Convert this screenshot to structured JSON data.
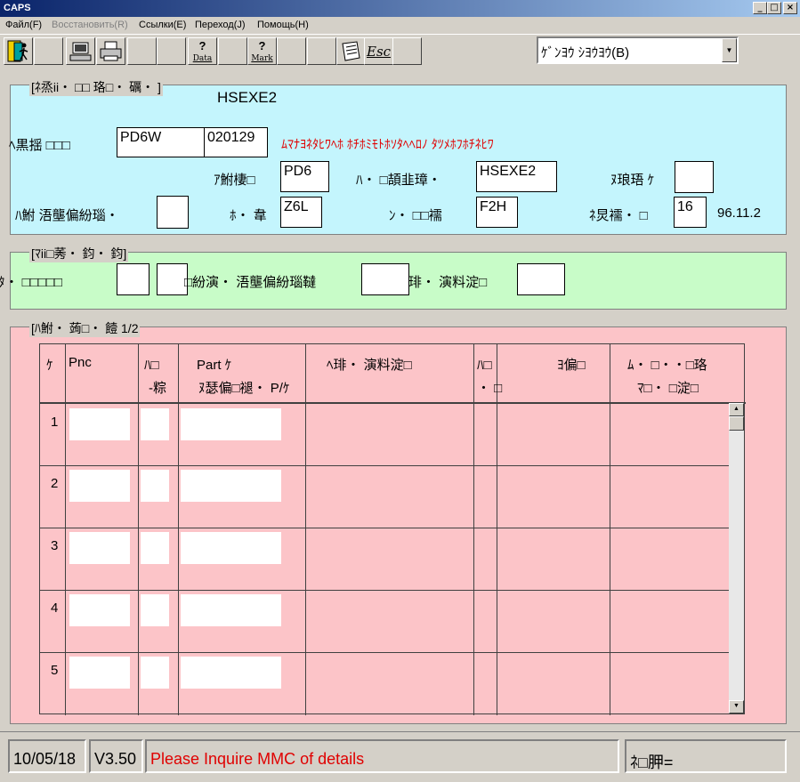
{
  "window": {
    "title": "CAPS",
    "minimize": "_",
    "maximize": "□",
    "close": "×"
  },
  "menu": [
    {
      "label": "Файл(F)",
      "disabled": false
    },
    {
      "label": "Восстановить(R)",
      "disabled": true
    },
    {
      "label": "Ссылки(E)",
      "disabled": false
    },
    {
      "label": "Переход(J)",
      "disabled": false
    },
    {
      "label": "Помощь(H)",
      "disabled": false
    }
  ],
  "toolbar": {
    "data_label": "Data",
    "mark_label": "Mark",
    "esc_label": "Esc",
    "help_glyph": "?"
  },
  "combo": {
    "value": "ｹﾞﾝﾖｳ ｼﾖｳﾖｳ(B)",
    "arrow": "▼"
  },
  "panel1": {
    "legend": "[ﾈ烝ii・ □□ 珞□・ 礪・ ]",
    "model_code": "HSEXE2",
    "row1_label": "ﾍ黒揺 □□□",
    "field_pd6w": "PD6W",
    "field_date": "020129",
    "red_text": "ﾑﾏﾅﾖﾈﾀﾋﾜﾍﾎ ﾎﾁﾎﾐﾓﾄﾎｿﾀﾍﾍﾛﾉ ﾀﾂﾒﾎﾌﾎﾁﾈﾋﾜ",
    "label_a": "ｱ鮒棲□",
    "field_a": "PD6",
    "label_b": "ﾊ・ □頡韭璋・",
    "field_b": "HSEXE2",
    "label_c": "ﾇ琅珸 ｹ",
    "field_c": "",
    "label_d": "ﾊ鮒 浯壟偏紛瑙・",
    "field_d": "",
    "label_e": "ﾎ・ 韋",
    "field_e": "Z6L",
    "label_f": "ﾝ・ □□襦",
    "field_f": "F2H",
    "label_g": "ﾈ炅襦・ □",
    "field_g": "16",
    "version_date": "96.11.2"
  },
  "panel2": {
    "legend": "[ﾏii□莠・ 鈞・ 鈞]",
    "label_a": "ﾀ・ □□□□□",
    "field_a1": "",
    "field_a2": "",
    "label_b": "□紛演・ 浯壟偏紛瑙韃",
    "field_b": "",
    "label_c": "琲・ 演料淀□",
    "field_c": ""
  },
  "panel3": {
    "legend": "[ﾊ鮒・ 蒟□・ 饐 1/2",
    "headers": {
      "col1": "ｹ",
      "col2": "Pnc",
      "col3a": "ﾊ□",
      "col3b": "-粽",
      "col4a": "Part ｹ",
      "col4b": "ﾇ瑟偏□褪・  P/ｹ",
      "col5": "ﾍ琲・ 演料淀□",
      "col6a": "ﾊ□",
      "col6b": "・ □",
      "col7": "ﾖ偏□",
      "col8a": "ﾑ・ □・・□珞",
      "col8b": "ﾏ□・ □淀□"
    },
    "rows": [
      "1",
      "2",
      "3",
      "4",
      "5"
    ],
    "scroll_up": "▲",
    "scroll_down": "▼"
  },
  "status": {
    "date": "10/05/18",
    "version": "V3.50",
    "message": "Please Inquire MMC of details",
    "right": "ﾈ□胛="
  },
  "colors": {
    "panel1_bg": "#c4f5fd",
    "panel2_bg": "#c8fcc8",
    "panel3_bg": "#fcc4c8",
    "status_msg": "#e00000"
  }
}
